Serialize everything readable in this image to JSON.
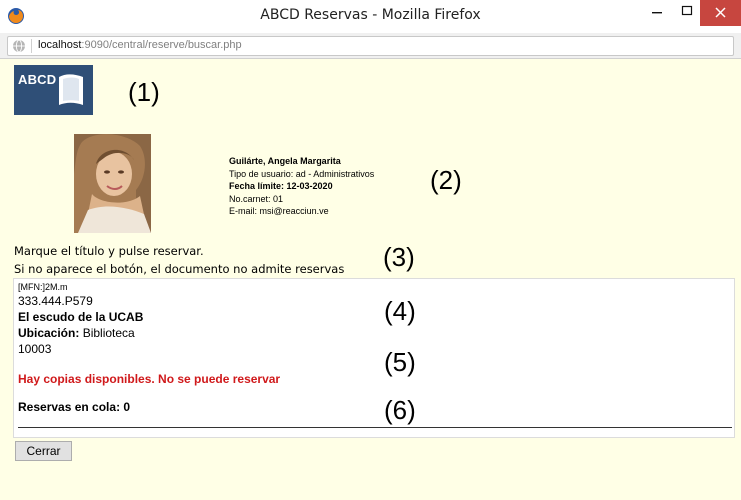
{
  "window": {
    "title": "ABCD Reservas - Mozilla Firefox",
    "url_host": "localhost",
    "url_rest": ":9090/central/reserve/buscar.php"
  },
  "logo": {
    "text": "ABCD"
  },
  "markers": [
    "(1)",
    "(2)",
    "(3)",
    "(4)",
    "(5)",
    "(6)"
  ],
  "user": {
    "name": "Guilárte, Angela Margarita",
    "type_label": "Tipo de usuario:",
    "type_value": "ad - Administrativos",
    "deadline_label": "Fecha límite:",
    "deadline_value": "12-03-2020",
    "card_label": "No.carnet:",
    "card_value": "01",
    "email_label": "E-mail:",
    "email_value": "msi@reacciun.ve"
  },
  "instructions": {
    "line1": "Marque el título y pulse reservar.",
    "line2": "Si no aparece el botón, el documento no admite reservas"
  },
  "record": {
    "mfn": "[MFN:]2M.m",
    "call_number": "333.444.P579",
    "title": "El escudo de la UCAB",
    "location_label": "Ubicación:",
    "location_value": "Biblioteca",
    "inventory": "10003",
    "availability": "Hay copias disponibles. No se puede reservar",
    "queue_label": "Reservas en cola:",
    "queue_value": "0"
  },
  "buttons": {
    "close": "Cerrar"
  },
  "colors": {
    "page_bg": "#ffffe6",
    "alert": "#d0191b",
    "close_hover": "#c7463f"
  }
}
